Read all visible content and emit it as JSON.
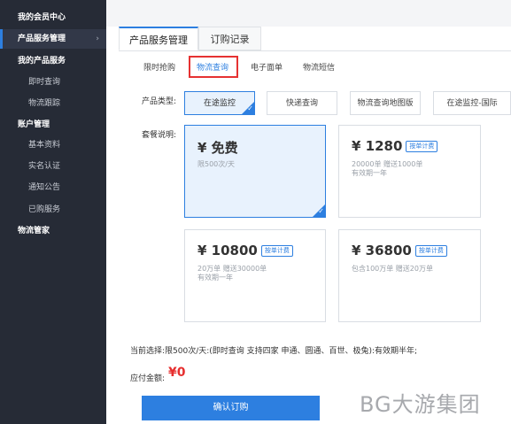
{
  "sidebar": {
    "items": [
      {
        "label": "我的会员中心"
      },
      {
        "label": "产品服务管理"
      },
      {
        "label": "我的产品服务"
      },
      {
        "label": "即时查询"
      },
      {
        "label": "物流跟踪"
      },
      {
        "label": "账户管理"
      },
      {
        "label": "基本资料"
      },
      {
        "label": "实名认证"
      },
      {
        "label": "通知公告"
      },
      {
        "label": "已购服务"
      },
      {
        "label": "物流管家"
      }
    ],
    "chevron": "›"
  },
  "main_tabs": [
    {
      "label": "产品服务管理"
    },
    {
      "label": "订购记录"
    }
  ],
  "sub_tabs": [
    {
      "label": "限时抢购"
    },
    {
      "label": "物流查询"
    },
    {
      "label": "电子面单"
    },
    {
      "label": "物流短信"
    }
  ],
  "product_type": {
    "label": "产品类型:",
    "options": [
      {
        "label": "在途监控"
      },
      {
        "label": "快递查询"
      },
      {
        "label": "物流查询地图版"
      },
      {
        "label": "在途监控-国际"
      }
    ],
    "check": "✓"
  },
  "plans": {
    "label": "套餐说明:",
    "items": [
      {
        "price": "¥ 免费",
        "badge": "",
        "line1": "限500次/天",
        "line2": ""
      },
      {
        "price": "¥ 1280",
        "badge": "按单计费",
        "line1": "20000单  赠送1000单",
        "line2": "有效期一年"
      },
      {
        "price": "¥ 10800",
        "badge": "按单计费",
        "line1": "20万单  赠送30000单",
        "line2": "有效期一年"
      },
      {
        "price": "¥ 36800",
        "badge": "按单计费",
        "line1": "包含100万单  赠送20万单",
        "line2": ""
      }
    ]
  },
  "summary": {
    "current_selection": "当前选择:限500次/天:(即时查询 支持四家 申通、圆通、百世、极兔):有效期半年;",
    "pay_label": "应付金额:",
    "pay_amount": "¥0"
  },
  "confirm_label": "确认订购",
  "watermark": "BG大游集团",
  "colors": {
    "sidebar_bg": "#262b36",
    "accent": "#2d7fe0",
    "price_red": "#e62e2e",
    "highlight_box": "#e63232"
  }
}
